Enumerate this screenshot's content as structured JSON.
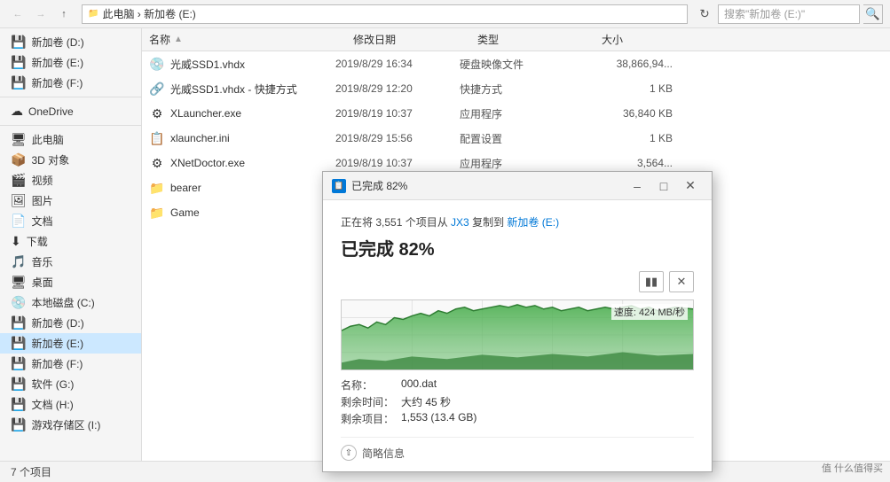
{
  "window": {
    "title": "新加卷 (E:)",
    "address": "此电脑 › 新加卷 (E:)",
    "search_placeholder": "搜索\"新加卷 (E:)\""
  },
  "sidebar": {
    "items": [
      {
        "id": "new-d",
        "label": "新加卷 (D:)",
        "icon": "💾"
      },
      {
        "id": "new-e",
        "label": "新加卷 (E:)",
        "icon": "💾"
      },
      {
        "id": "new-f",
        "label": "新加卷 (F:)",
        "icon": "💾"
      },
      {
        "id": "onedrive",
        "label": "OneDrive",
        "icon": "☁"
      },
      {
        "id": "this-pc",
        "label": "此电脑",
        "icon": "🖥"
      },
      {
        "id": "3d",
        "label": "3D 对象",
        "icon": "📦"
      },
      {
        "id": "video",
        "label": "视频",
        "icon": "🎬"
      },
      {
        "id": "picture",
        "label": "图片",
        "icon": "🖼"
      },
      {
        "id": "doc",
        "label": "文档",
        "icon": "📄"
      },
      {
        "id": "download",
        "label": "下载",
        "icon": "⬇"
      },
      {
        "id": "music",
        "label": "音乐",
        "icon": "🎵"
      },
      {
        "id": "desktop",
        "label": "桌面",
        "icon": "🖥"
      },
      {
        "id": "local-c",
        "label": "本地磁盘 (C:)",
        "icon": "💿"
      },
      {
        "id": "new-d2",
        "label": "新加卷 (D:)",
        "icon": "💾"
      },
      {
        "id": "new-e2",
        "label": "新加卷 (E:)",
        "icon": "💾",
        "active": true
      },
      {
        "id": "new-f2",
        "label": "新加卷 (F:)",
        "icon": "💾"
      },
      {
        "id": "software-g",
        "label": "软件 (G:)",
        "icon": "💾"
      },
      {
        "id": "doc-h",
        "label": "文档 (H:)",
        "icon": "💾"
      },
      {
        "id": "game-i",
        "label": "游戏存储区 (I:)",
        "icon": "💾"
      }
    ]
  },
  "columns": {
    "name": "名称",
    "date": "修改日期",
    "type": "类型",
    "size": "大小"
  },
  "files": [
    {
      "name": "光威SSD1.vhdx",
      "date": "2019/8/29 16:34",
      "type": "硬盘映像文件",
      "size": "38,866,94...",
      "icon": "💿"
    },
    {
      "name": "光威SSD1.vhdx - 快捷方式",
      "date": "2019/8/29 12:20",
      "type": "快捷方式",
      "size": "1 KB",
      "icon": "🔗"
    },
    {
      "name": "XLauncher.exe",
      "date": "2019/8/19 10:37",
      "type": "应用程序",
      "size": "36,840 KB",
      "icon": "⚙"
    },
    {
      "name": "xlauncher.ini",
      "date": "2019/8/29 15:56",
      "type": "配置设置",
      "size": "1 KB",
      "icon": "📋"
    },
    {
      "name": "XNetDoctor.exe",
      "date": "2019/8/19 10:37",
      "type": "应用程序",
      "size": "3,564...",
      "icon": "⚙"
    },
    {
      "name": "bearer",
      "date": "",
      "type": "",
      "size": "",
      "icon": "📁"
    },
    {
      "name": "Game",
      "date": "",
      "type": "",
      "size": "",
      "icon": "📁"
    }
  ],
  "status_bar": {
    "item_count": "7 个项目"
  },
  "dialog": {
    "title": "已完成 82%",
    "title_icon": "📋",
    "copying_text": "正在将 3,551 个项目从 JX3 复制到 新加卷 (E:)",
    "source": "JX3",
    "destination": "新加卷 (E:)",
    "percent_label": "已完成 82%",
    "speed_label": "速度: 424 MB/秒",
    "filename_label": "名称：",
    "filename_value": "000.dat",
    "time_label": "剩余时间：",
    "time_value": "大约 45 秒",
    "items_label": "剩余项目：",
    "items_value": "1,553 (13.4 GB)",
    "footer_label": "简略信息",
    "progress_percent": 82,
    "pause_icon": "⏸",
    "stop_icon": "✕"
  },
  "watermark": "值 什么值得买"
}
